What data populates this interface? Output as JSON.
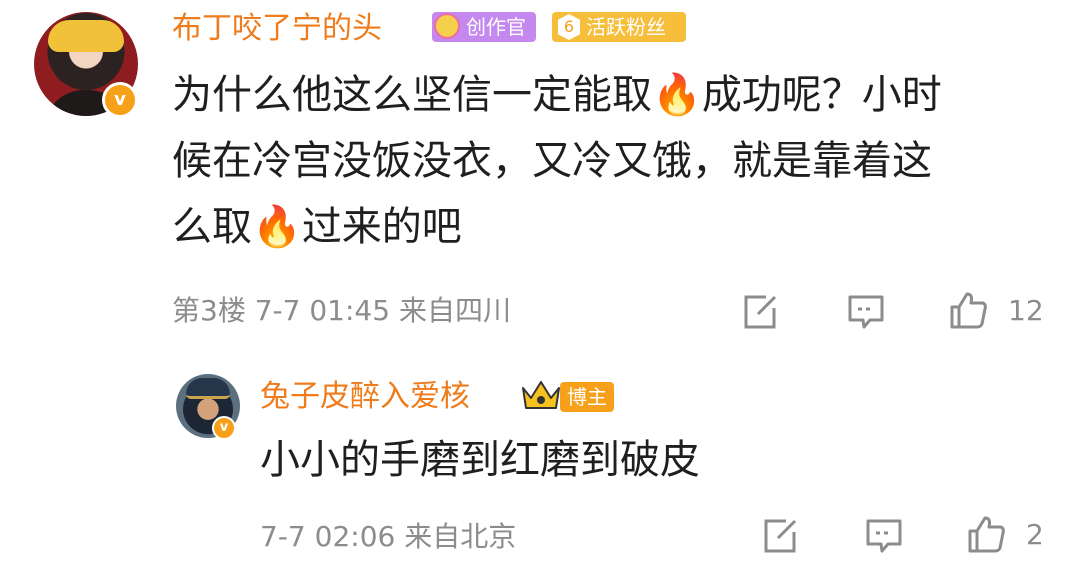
{
  "comment": {
    "username": "布丁咬了宁的头",
    "badges": {
      "creator": "创作官",
      "fan_level": "6",
      "fan": "活跃粉丝"
    },
    "verified_mark": "v",
    "lines": [
      [
        "为什么他这么坚信一定能取",
        "🔥",
        "成功呢？小时"
      ],
      [
        "候在冷宫没饭没衣，又冷又饿，就是靠着这"
      ],
      [
        "么取",
        "🔥",
        "过来的吧"
      ]
    ],
    "floor": "第3楼",
    "time": "7-7 01:45",
    "location": "来自四川",
    "likes": "12"
  },
  "reply": {
    "username": "兔子皮醉入爱核",
    "badge": "博主",
    "verified_mark": "v",
    "text": "小小的手磨到红磨到破皮",
    "time": "7-7 02:06",
    "location": "来自北京",
    "likes": "2"
  },
  "icons": {
    "repost": "share-edit-icon",
    "comment": "comment-bubble-icon",
    "like": "thumbs-up-icon"
  },
  "colors": {
    "username": "#ef7b1b",
    "meta": "#8c8c8c",
    "text": "#1f1f1f",
    "creator_badge": "#c488ef",
    "fan_badge": "#f7be3c",
    "host_badge": "#f7a11a"
  }
}
